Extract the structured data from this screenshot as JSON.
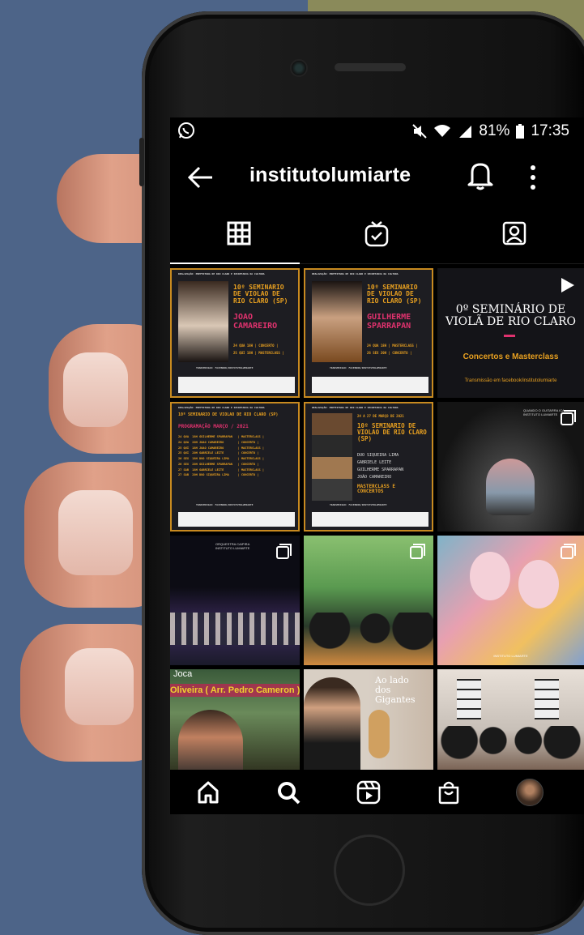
{
  "status_bar": {
    "battery": "81%",
    "time": "17:35"
  },
  "profile": {
    "username": "institutolumiarte"
  },
  "tabs": [
    {
      "name": "posts-grid",
      "active": true
    },
    {
      "name": "igtv",
      "active": false
    },
    {
      "name": "tagged",
      "active": false
    }
  ],
  "posts": [
    {
      "header": "REALIZAÇÃO: PREFEITURA DE RIO CLARO E SECRETARIA DA CULTURA",
      "title": "10º SEMINARIO DE VIOLAO DE RIO CLARO (SP)",
      "artist": "JOAO CAMAREIRO",
      "line1": "24 QUA  18H | CONCERTO |",
      "line2": "25 QUI  18H | MASTERCLASS |",
      "footer": "TRANSMISSAO: FACEBOOK/INSTITUTOLUMIARTE"
    },
    {
      "header": "REALIZAÇÃO: PREFEITURA DE RIO CLARO E SECRETARIA DA CULTURA",
      "title": "10º SEMINARIO DE VIOLAO DE RIO CLARO (SP)",
      "artist": "GUILHERME SPARRAPAN",
      "line1": "24 QUA  18H | MASTERCLASS |",
      "line2": "26 SEX  20H | CONCERTO |",
      "footer": "TRANSMISSAO: FACEBOOK/INSTITUTOLUMIARTE"
    },
    {
      "title": "0º SEMINÁRIO DE VIOLÃ DE RIO CLARO",
      "subtitle": "Concertos e Masterclass",
      "footer": "Transmissão em facebook/institutolumiarte"
    },
    {
      "header": "REALIZAÇÃO: PREFEITURA DE RIO CLARO E SECRETARIA DA CULTURA",
      "title": "10º SEMINARIO DE VIOLAO DE RIO CLARO (SP)",
      "subtitle": "PROGRAMAÇÃO  MARÇO / 2021",
      "schedule": [
        "24 QUA  18H GUILHERME SPARRAPAN   | MASTERCLASS |",
        "24 QUA  20H JOAO CAMAREIRO        | CONCERTO |",
        "25 QUI  18H JOAO CAMAREIRO        | MASTERCLASS |",
        "25 QUI  20H GABRIELE LEITE        | CONCERTO |",
        "26 SEX  18H DUO SIQUEIRA LIMA     | MASTERCLASS |",
        "26 SEX  20H GUILHERME SPARRAPAN   | CONCERTO |",
        "27 SAB  18H GABRIELE LEITE        | MASTERCLASS |",
        "27 SAB  20H DUO SIQUEIRA LIMA     | CONCERTO |"
      ],
      "footer": "TRANSMISSAO: FACEBOOK/INSTITUTOLUMIARTE"
    },
    {
      "header": "REALIZAÇÃO: PREFEITURA DE RIO CLARO E SECRETARIA DA CULTURA",
      "dates": "24 A 27 DE MARÇO DE 2021",
      "title": "10º SEMINARIO DE VIOLAO DE RIO CLARO (SP)",
      "artists": [
        "DUO SIQUEIRA LIMA",
        "GABRIELE LEITE",
        "GUILHERME SPARRAPAN",
        "JOÃO CAMAREIRO"
      ],
      "subtitle": "MASTERCLASS E CONCERTOS",
      "footer": "TRANSMISSAO: FACEBOOK/INSTITUTOLUMIARTE"
    },
    {
      "overlay": "QUANDO O GUITARRA ICA INSTITUTO LUMIARTE"
    },
    {
      "overlay": "ORQUESTRA CAIPIRA INSTITUTO LUMIARTE"
    },
    {
      "overlay": ""
    },
    {
      "overlay": "INSTITUTO LUMIARTE"
    },
    {
      "caption_line1": "Joca",
      "caption_line2": "Oliveira ( Arr. Pedro Cameron )"
    },
    {
      "caption": "Ao lado dos Gigantes"
    },
    {
      "caption": ""
    }
  ],
  "nav": [
    "home",
    "search",
    "reels",
    "shop",
    "profile"
  ],
  "colors": {
    "accent_orange": "#e8a020",
    "accent_pink": "#e0326e",
    "poster_bg": "#1d1d22",
    "background": "#4d6488"
  }
}
